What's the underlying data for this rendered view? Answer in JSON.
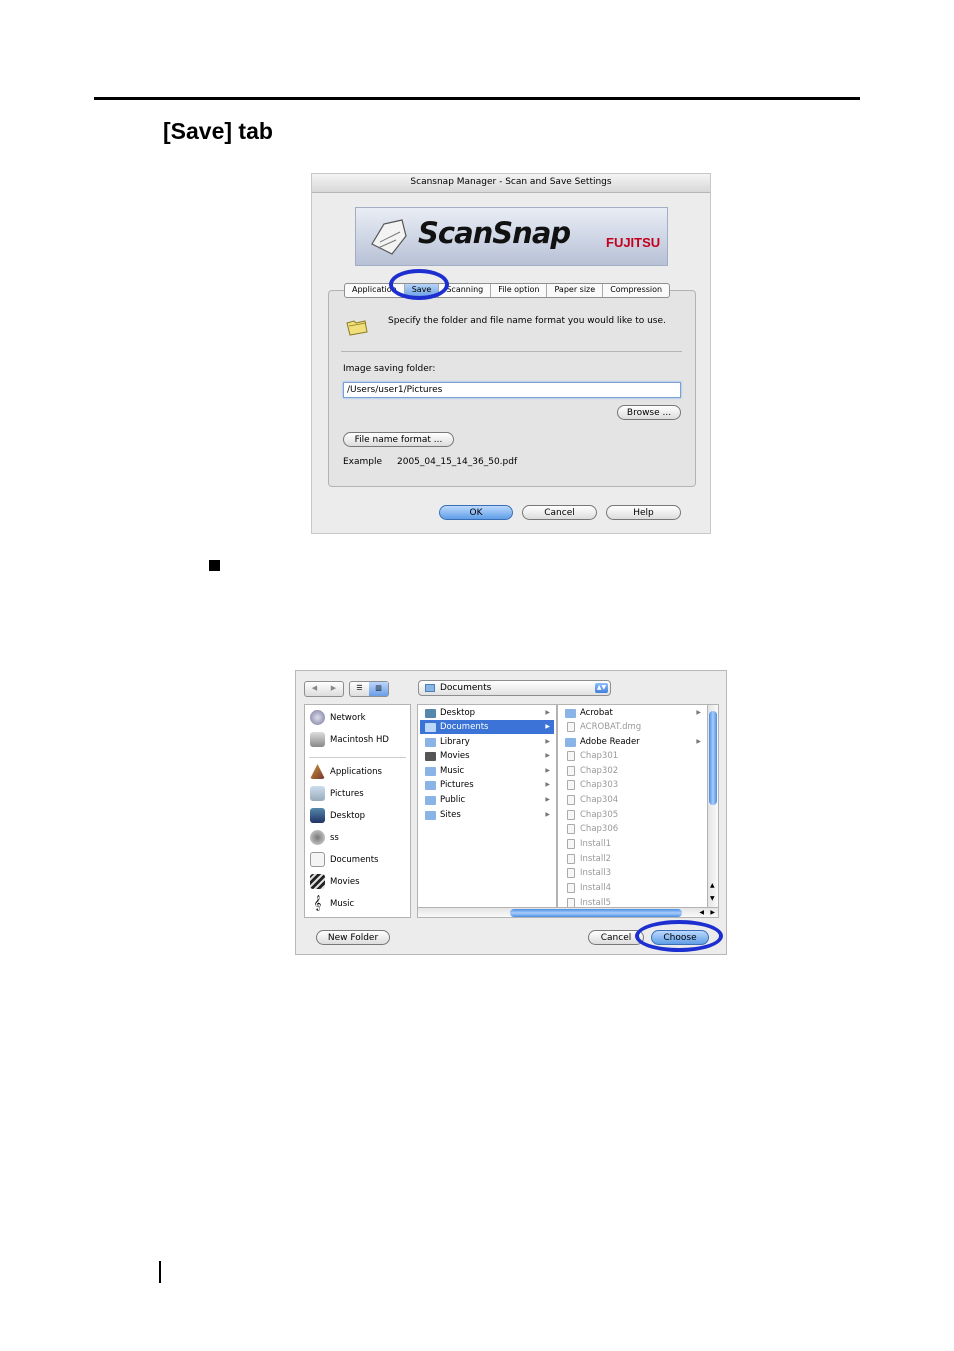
{
  "page": {
    "heading": "[Save] tab"
  },
  "settings_dialog": {
    "title": "Scansnap Manager - Scan and Save Settings",
    "banner_logo": "ScanSnap",
    "banner_brand": "FUJITSU",
    "tabs": [
      "Application",
      "Save",
      "Scanning",
      "File option",
      "Paper size",
      "Compression"
    ],
    "selected_tab": "Save",
    "description": "Specify the folder and file name format you would like to use.",
    "image_folder_label": "Image saving folder:",
    "image_folder_value": "/Users/user1/Pictures",
    "browse_label": "Browse ...",
    "file_name_format_label": "File name format ...",
    "example_label": "Example",
    "example_value": "2005_04_15_14_36_50.pdf",
    "ok_label": "OK",
    "cancel_label": "Cancel",
    "help_label": "Help",
    "colors": {
      "highlight_circle": "#1e2fd0",
      "default_button": "#5f9ee6"
    }
  },
  "chooser_dialog": {
    "location": "Documents",
    "sidebar": [
      "Network",
      "Macintosh HD",
      "Applications",
      "Pictures",
      "Desktop",
      "ss",
      "Documents",
      "Movies",
      "Music"
    ],
    "column1": [
      "Desktop",
      "Documents",
      "Library",
      "Movies",
      "Music",
      "Pictures",
      "Public",
      "Sites"
    ],
    "column1_selected": "Documents",
    "column2": [
      "Acrobat",
      "ACROBAT.dmg",
      "Adobe Reader",
      "Chap301",
      "Chap302",
      "Chap303",
      "Chap304",
      "Chap305",
      "Chap306",
      "Install1",
      "Install2",
      "Install3",
      "Install4",
      "Install5"
    ],
    "new_folder_label": "New Folder",
    "cancel_label": "Cancel",
    "choose_label": "Choose",
    "colors": {
      "selection": "#3b74d6"
    }
  }
}
